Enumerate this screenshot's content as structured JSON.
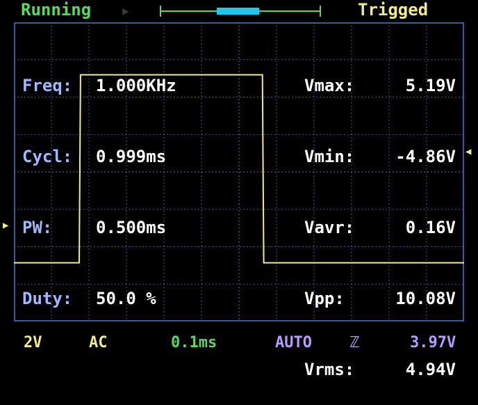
{
  "header": {
    "status": "Running",
    "trigger_status": "Trigged",
    "memory_window": {
      "start": 0.35,
      "end": 0.62
    }
  },
  "measurements_left": [
    {
      "label": "Freq:",
      "value": "1.000KHz"
    },
    {
      "label": "Cycl:",
      "value": "0.999ms"
    },
    {
      "label": "PW:",
      "value": "0.500ms"
    },
    {
      "label": "Duty:",
      "value": "50.0 %"
    }
  ],
  "measurements_right": [
    {
      "label": "Vmax:",
      "value": "5.19V"
    },
    {
      "label": "Vmin:",
      "value": "-4.86V"
    },
    {
      "label": "Vavr:",
      "value": "0.16V"
    },
    {
      "label": "Vpp:",
      "value": "10.08V"
    },
    {
      "label": "Vrms:",
      "value": "4.94V"
    }
  ],
  "footer": {
    "volts_per_div": "2V",
    "coupling": "AC",
    "time_per_div": "0.1ms",
    "trigger_mode": "AUTO",
    "trigger_edge": "ℤ",
    "trigger_level": "3.97V"
  },
  "colors": {
    "grid": "#4b78c8",
    "trace": "#f2ea8c",
    "status": "#5fd65f",
    "accent": "#1ec8e6",
    "label": "#9fb8ff"
  },
  "trace_points": [
    [
      0.0,
      -4.86
    ],
    [
      0.145,
      -4.86
    ],
    [
      0.148,
      5.19
    ],
    [
      0.552,
      5.19
    ],
    [
      0.555,
      -4.86
    ],
    [
      1.0,
      -4.86
    ]
  ]
}
